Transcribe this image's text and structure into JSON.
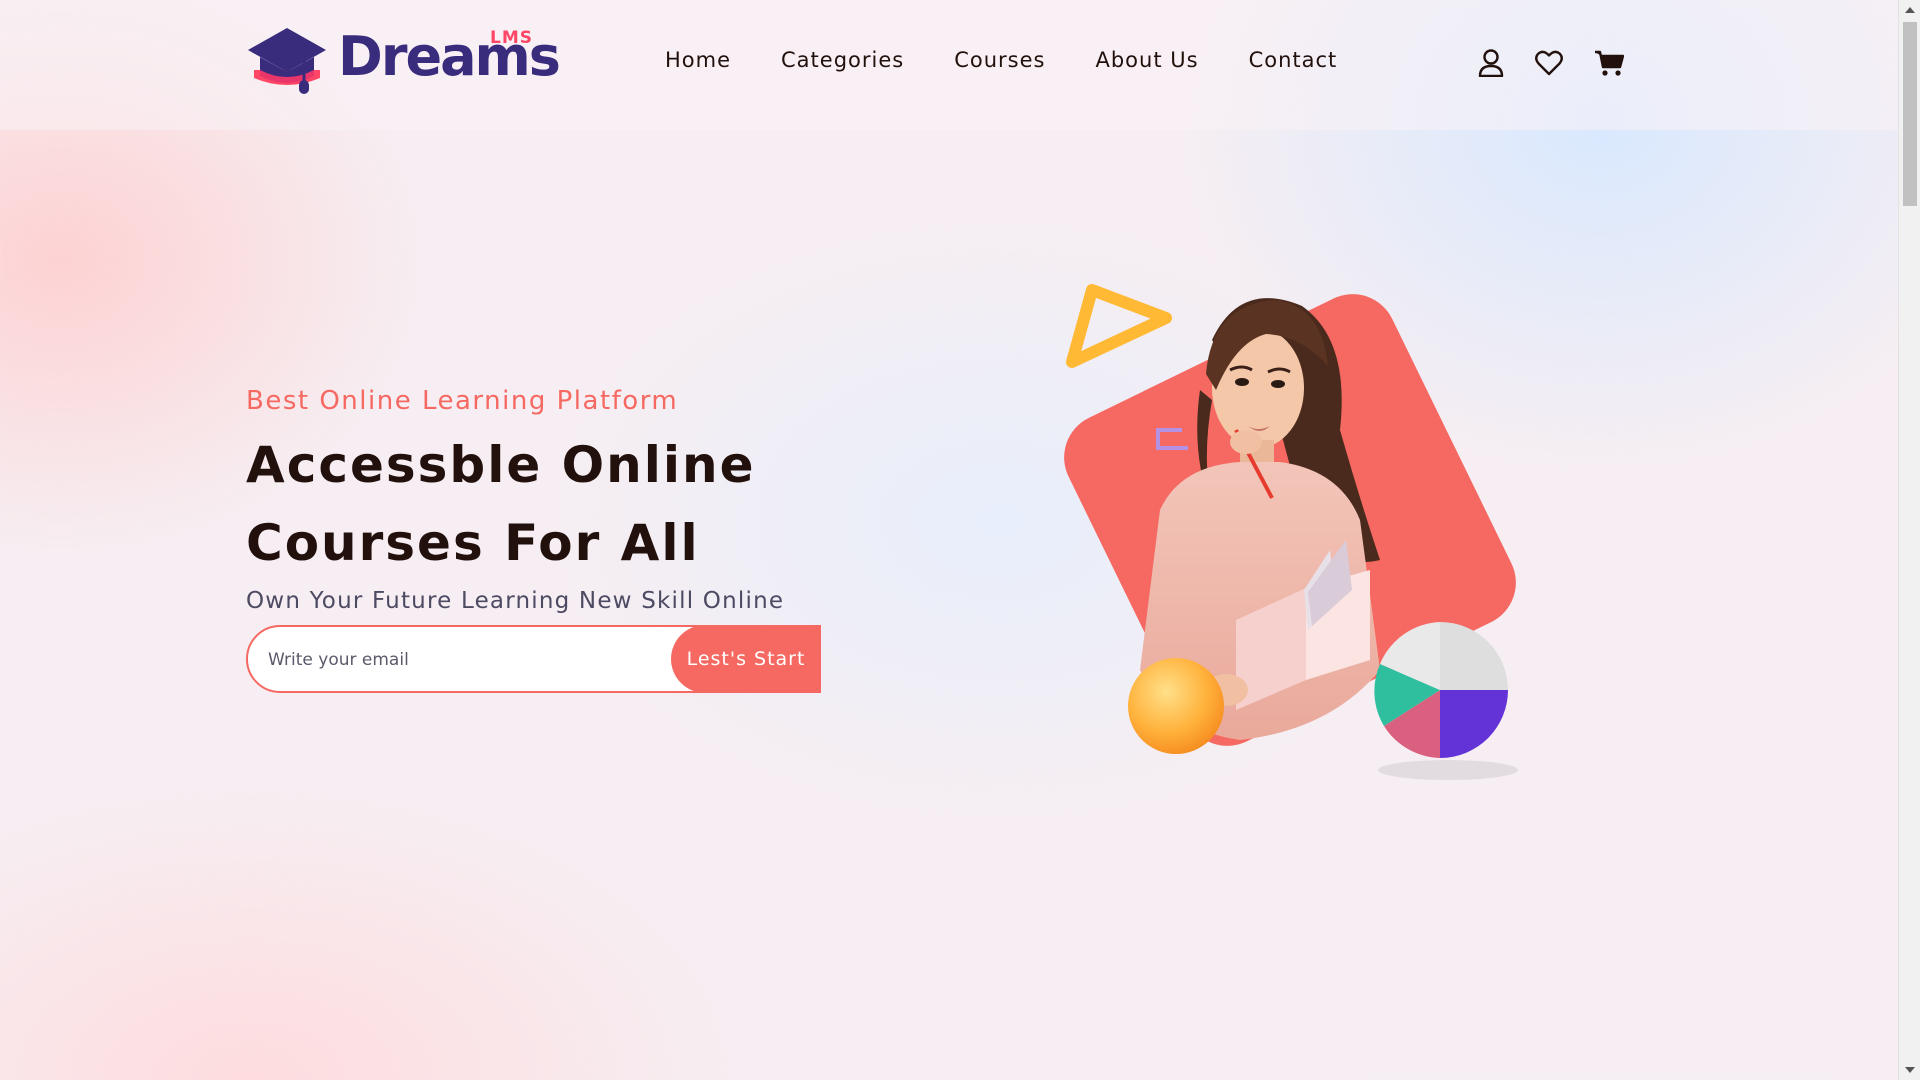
{
  "brand": {
    "name": "Dreams",
    "badge": "LMS",
    "colors": {
      "primary": "#392c7d",
      "accent": "#ff4667",
      "coral": "#f66962"
    }
  },
  "nav": {
    "items": [
      "Home",
      "Categories",
      "Courses",
      "About Us",
      "Contact"
    ]
  },
  "header_icons": [
    "user-icon",
    "heart-icon",
    "cart-icon"
  ],
  "hero": {
    "tagline": "Best Online Learning Platform",
    "headline_line1": "Accessble Online",
    "headline_line2": "Courses For All",
    "subline": "Own Your Future Learning New Skill Online",
    "email_placeholder": "Write your email",
    "email_value": "",
    "cta_label": "Lest's Start"
  }
}
